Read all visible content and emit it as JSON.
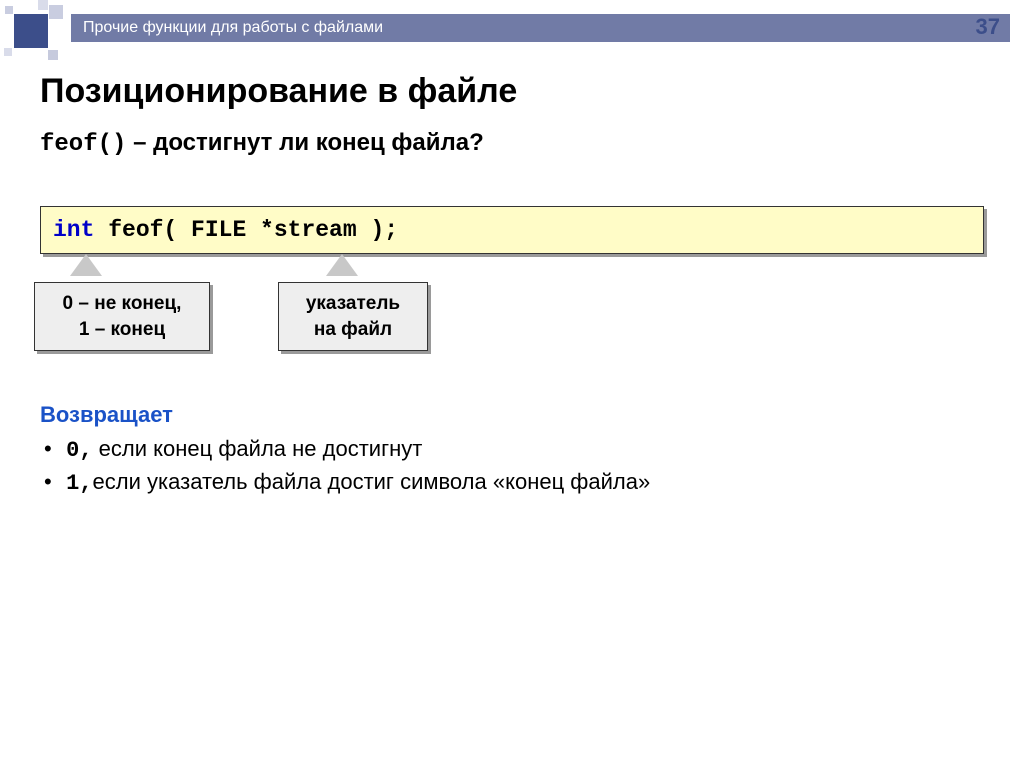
{
  "page_number": "37",
  "header_title": "Прочие функции для работы с файлами",
  "main_title": "Позиционирование в файле",
  "subtitle_func": "feof()",
  "subtitle_rest": " – достигнут ли конец файла?",
  "code": {
    "kw": "int",
    "rest": " feof( FILE *stream );"
  },
  "callout1_line1": "0 – не конец,",
  "callout1_line2": "1 – конец",
  "callout2_line1": "указатель",
  "callout2_line2": "на файл",
  "returns_title": "Возвращает",
  "ret1_code": "0,",
  "ret1_text": " если конец файла не достигнут",
  "ret2_code": "1,",
  "ret2_text": "если указатель файла достиг символа «конец файла»"
}
